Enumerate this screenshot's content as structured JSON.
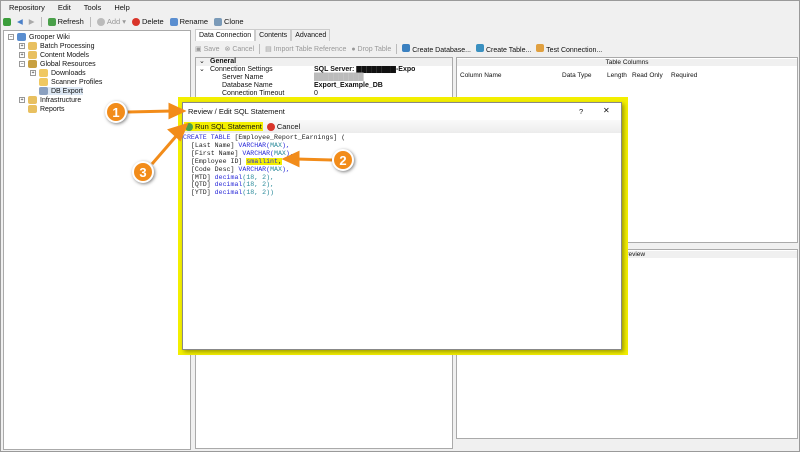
{
  "menu": [
    "Repository",
    "Edit",
    "Tools",
    "Help"
  ],
  "toolbar": {
    "refresh": "Refresh",
    "add": "Add",
    "delete": "Delete",
    "rename": "Rename",
    "clone": "Clone"
  },
  "tree": {
    "root": "Grooper Wiki",
    "items": [
      "Batch Processing",
      "Content Models",
      "Global Resources",
      "Downloads",
      "Scanner Profiles",
      "DB Export",
      "Infrastructure",
      "Reports"
    ]
  },
  "tabs": [
    "Data Connection",
    "Contents",
    "Advanced"
  ],
  "toolbar2": {
    "save": "Save",
    "cancel": "Cancel",
    "import": "Import Table Reference",
    "drop": "Drop Table",
    "create_db": "Create Database...",
    "create_table": "Create Table...",
    "test": "Test Connection..."
  },
  "props": {
    "general": "General",
    "conn_settings": "Connection Settings",
    "conn_value": "SQL Server: ████████-Expo",
    "server_name": "Server Name",
    "server_value": "██████████",
    "database_name": "Database Name",
    "database_value": "Export_Example_DB",
    "timeout": "Connection Timeout",
    "timeout_value": "0"
  },
  "table_columns": {
    "title": "Table Columns",
    "headers": [
      "Column Name",
      "Data Type",
      "Length",
      "Read Only",
      "Required"
    ]
  },
  "preview": {
    "title": "Preview"
  },
  "dialog": {
    "title": "Review / Edit SQL Statement",
    "help": "?",
    "close": "✕",
    "run": "Run SQL Statement",
    "cancel": "Cancel",
    "sql": {
      "l1a": "CREATE TABLE",
      "l1b": " [Employee_Report_Earnings] (",
      "l2a": "  [Last Name] ",
      "l2b": "VARCHAR(",
      "l2c": "MAX",
      "l2d": "),",
      "l3a": "  [First Name] ",
      "l3b": "VARCHAR(",
      "l3c": "MAX",
      "l3d": "),",
      "l4a": "  [Employee ID] ",
      "l4b": "smallint",
      "l4c": ",",
      "l5a": "  [Code Desc] ",
      "l5b": "VARCHAR(",
      "l5c": "MAX",
      "l5d": "),",
      "l6a": "  [MTD] ",
      "l6b": "decimal",
      "l6c": "(18, 2),",
      "l7a": "  [QTD] ",
      "l7b": "decimal",
      "l7c": "(18, 2),",
      "l8a": "  [YTD] ",
      "l8b": "decimal",
      "l8c": "(18, 2))"
    }
  },
  "callouts": [
    "1",
    "2",
    "3"
  ],
  "colors": {
    "highlight": "#f3ef00",
    "callout": "#f28c1a",
    "keyword": "#2b2bd9"
  }
}
